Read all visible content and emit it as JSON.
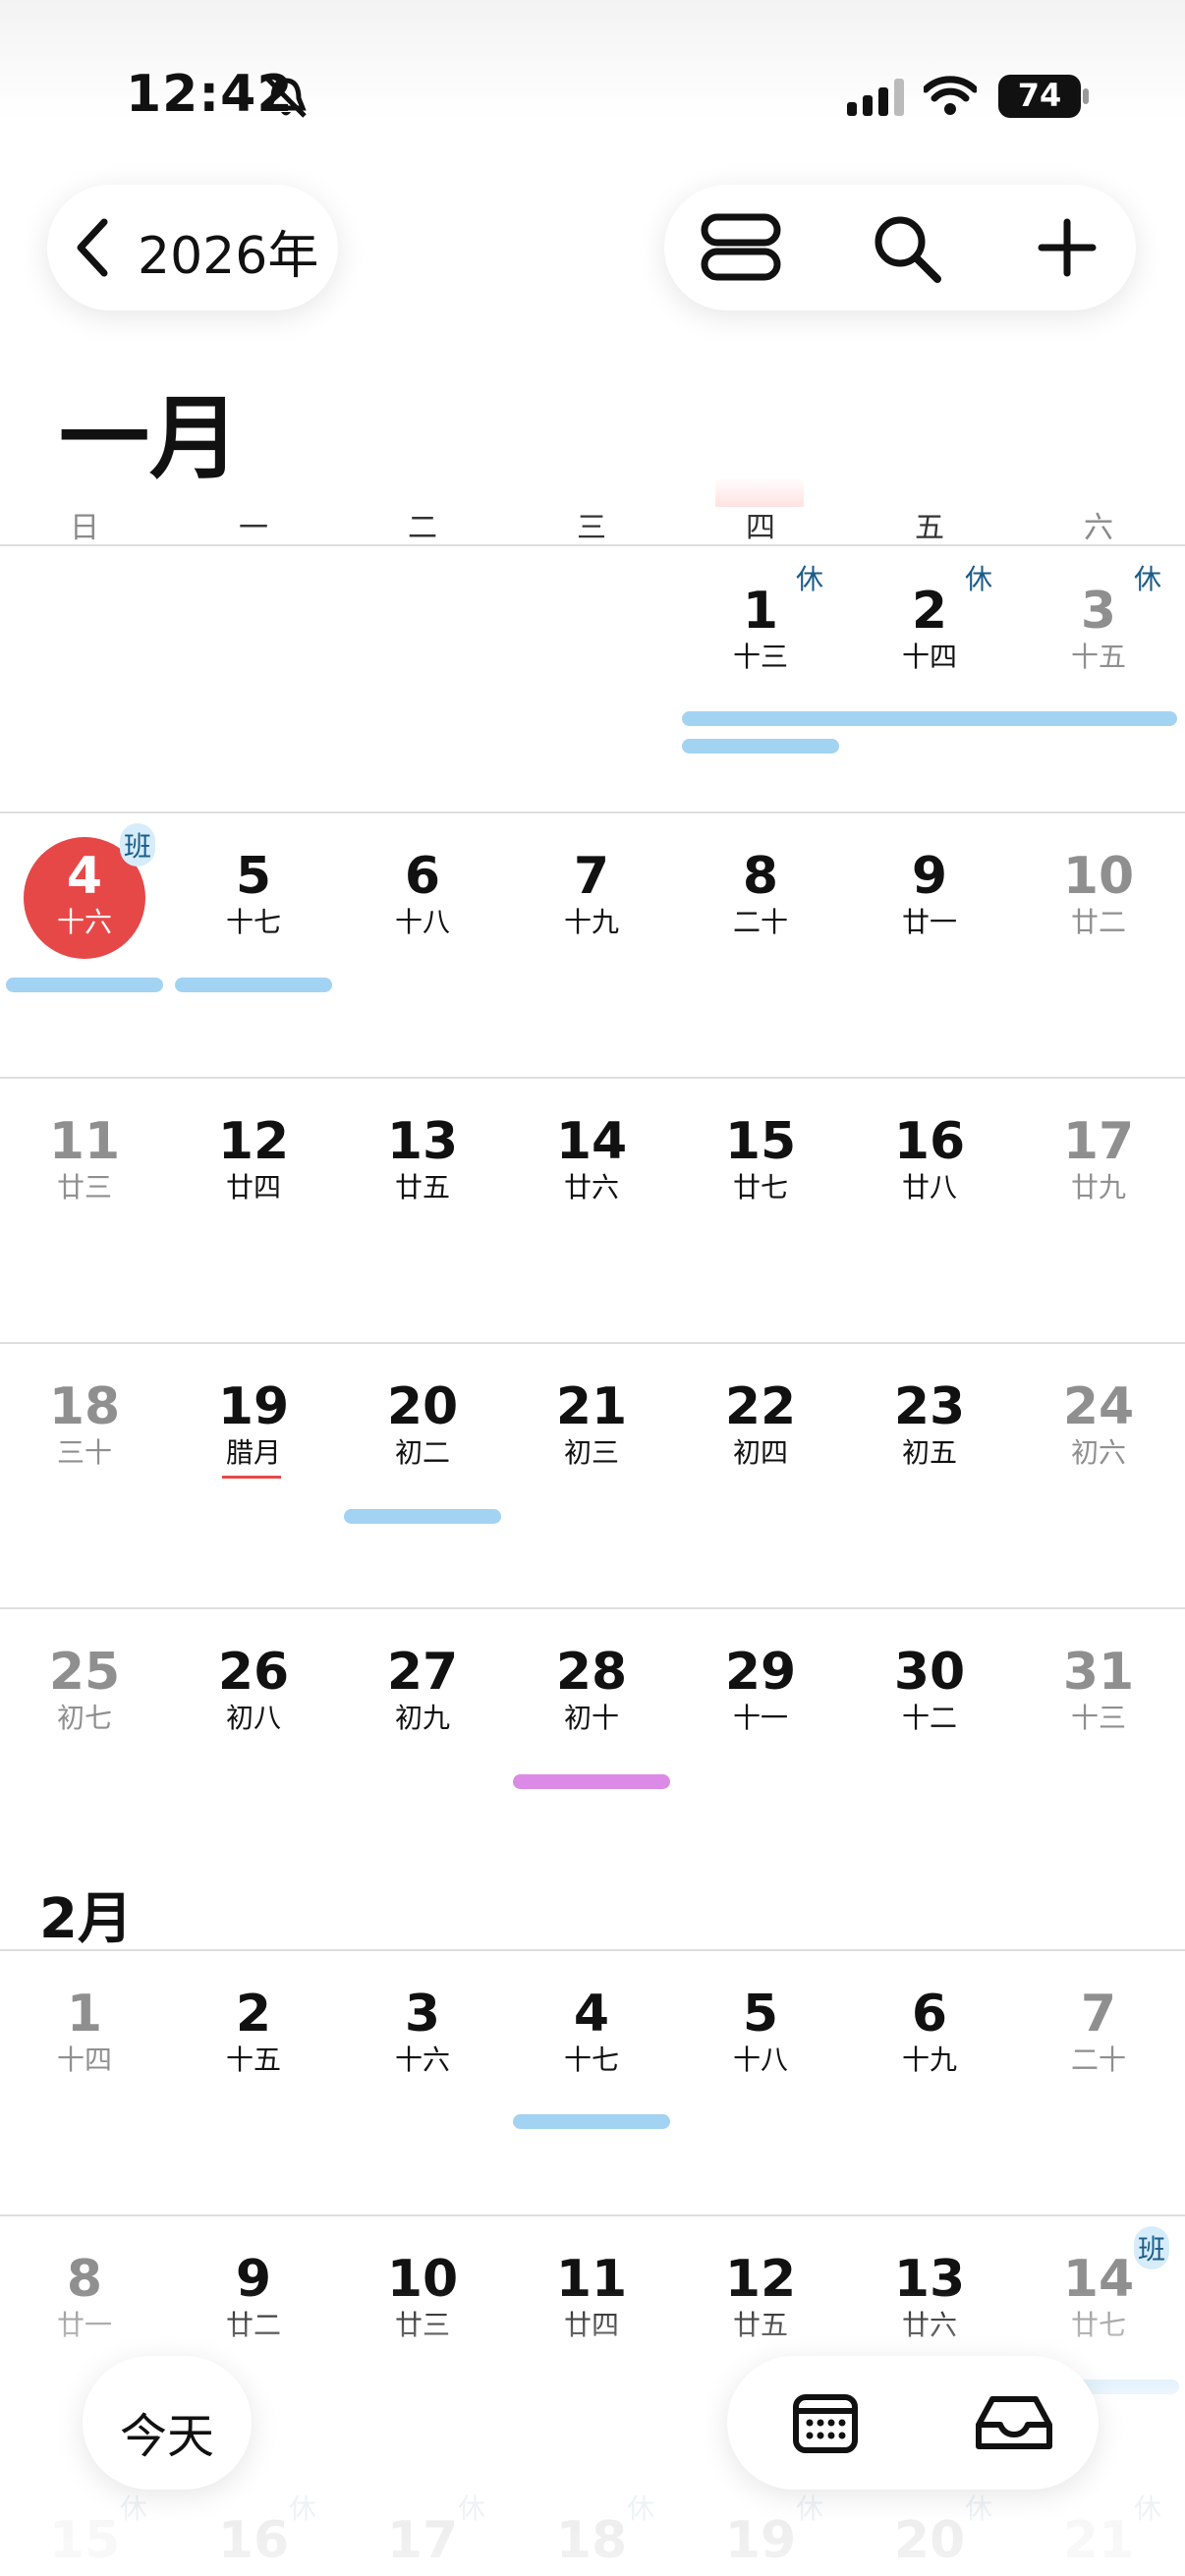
{
  "status_bar": {
    "time": "12:42",
    "battery": "74"
  },
  "header": {
    "year": "2026年"
  },
  "january": {
    "title": "一月",
    "weekdays": [
      "日",
      "一",
      "二",
      "三",
      "四",
      "五",
      "六"
    ],
    "weeks": [
      [
        null,
        null,
        null,
        null,
        {
          "d": "1",
          "l": "十三",
          "b": "休"
        },
        {
          "d": "2",
          "l": "十四",
          "b": "休"
        },
        {
          "d": "3",
          "l": "十五",
          "b": "休"
        }
      ],
      [
        {
          "d": "4",
          "l": "十六",
          "b": "班"
        },
        {
          "d": "5",
          "l": "十七"
        },
        {
          "d": "6",
          "l": "十八"
        },
        {
          "d": "7",
          "l": "十九"
        },
        {
          "d": "8",
          "l": "二十"
        },
        {
          "d": "9",
          "l": "廿一"
        },
        {
          "d": "10",
          "l": "廿二"
        }
      ],
      [
        {
          "d": "11",
          "l": "廿三"
        },
        {
          "d": "12",
          "l": "廿四"
        },
        {
          "d": "13",
          "l": "廿五"
        },
        {
          "d": "14",
          "l": "廿六"
        },
        {
          "d": "15",
          "l": "廿七"
        },
        {
          "d": "16",
          "l": "廿八"
        },
        {
          "d": "17",
          "l": "廿九"
        }
      ],
      [
        {
          "d": "18",
          "l": "三十"
        },
        {
          "d": "19",
          "l": "腊月"
        },
        {
          "d": "20",
          "l": "初二"
        },
        {
          "d": "21",
          "l": "初三"
        },
        {
          "d": "22",
          "l": "初四"
        },
        {
          "d": "23",
          "l": "初五"
        },
        {
          "d": "24",
          "l": "初六"
        }
      ],
      [
        {
          "d": "25",
          "l": "初七"
        },
        {
          "d": "26",
          "l": "初八"
        },
        {
          "d": "27",
          "l": "初九"
        },
        {
          "d": "28",
          "l": "初十"
        },
        {
          "d": "29",
          "l": "十一"
        },
        {
          "d": "30",
          "l": "十二"
        },
        {
          "d": "31",
          "l": "十三"
        }
      ]
    ]
  },
  "february": {
    "title": "2月",
    "weeks": [
      [
        {
          "d": "1",
          "l": "十四"
        },
        {
          "d": "2",
          "l": "十五"
        },
        {
          "d": "3",
          "l": "十六"
        },
        {
          "d": "4",
          "l": "十七"
        },
        {
          "d": "5",
          "l": "十八"
        },
        {
          "d": "6",
          "l": "十九"
        },
        {
          "d": "7",
          "l": "二十"
        }
      ],
      [
        {
          "d": "8",
          "l": "廿一"
        },
        {
          "d": "9",
          "l": "廿二"
        },
        {
          "d": "10",
          "l": "廿三"
        },
        {
          "d": "11",
          "l": "廿四"
        },
        {
          "d": "12",
          "l": "廿五"
        },
        {
          "d": "13",
          "l": "廿六"
        },
        {
          "d": "14",
          "l": "廿七",
          "b": "班"
        }
      ],
      [
        {
          "d": "15",
          "b": "休"
        },
        {
          "d": "16",
          "b": "休"
        },
        {
          "d": "17",
          "b": "休"
        },
        {
          "d": "18",
          "b": "休"
        },
        {
          "d": "19",
          "b": "休"
        },
        {
          "d": "20",
          "b": "休"
        },
        {
          "d": "21",
          "b": "休"
        }
      ]
    ]
  },
  "bottom_bar": {
    "today_label": "今天"
  },
  "colors": {
    "accent_red": "#e64848",
    "event_blue": "#a3d3f3",
    "event_purple": "#db8be6"
  }
}
